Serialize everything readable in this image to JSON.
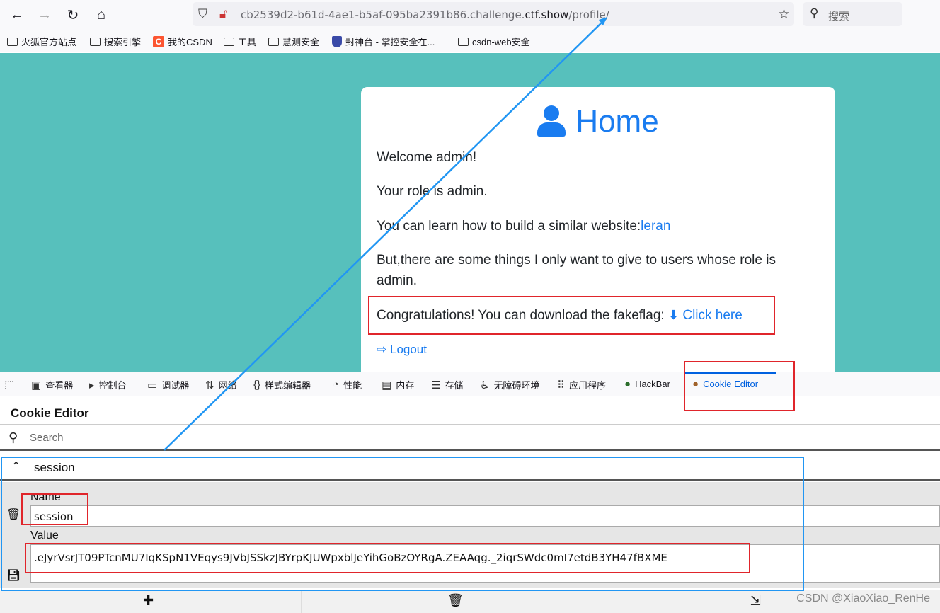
{
  "browser": {
    "url_host": "cb2539d2-b61d-4ae1-b5af-095ba2391b86.challenge.",
    "url_domain": "ctf.show",
    "url_path": "/profile/",
    "search_placeholder": "搜索"
  },
  "bookmarks": [
    "火狐官方站点",
    "搜索引擎",
    "我的CSDN",
    "工具",
    "慧测安全",
    "封神台 - 掌控安全在...",
    "csdn-web安全"
  ],
  "page": {
    "title": "Home",
    "welcome": "Welcome admin!",
    "role": "Your role is admin.",
    "learn_prefix": "You can learn how to build a similar website:",
    "learn_link": "leran",
    "note": "But,there are some things I only want to give to users whose role is admin.",
    "congrats": "Congratulations! You can download the fakeflag:",
    "click_here": "Click here",
    "logout": "Logout"
  },
  "devtools": {
    "tabs": [
      "查看器",
      "控制台",
      "调试器",
      "网络",
      "样式编辑器",
      "性能",
      "内存",
      "存储",
      "无障碍环境",
      "应用程序",
      "HackBar",
      "Cookie Editor"
    ],
    "active_tab": "Cookie Editor"
  },
  "cookie_editor": {
    "title": "Cookie Editor",
    "search_placeholder": "Search",
    "cookie_name": "session",
    "name_label": "Name",
    "name_value": "session",
    "value_label": "Value",
    "value": ".eJyrVsrJT09PTcnMU7IqKSpN1VEqys9JVbJSSkzJBYrpKJUWpxblJeYihGoBzOYRgA.ZEAAqg._2iqrSWdc0mI7etdB3YH47fBXME"
  },
  "watermark": "CSDN @XiaoXiao_RenHe",
  "colors": {
    "page_bg": "#57c0bc",
    "link": "#1a7cf0",
    "annotation_red": "#e0252b",
    "annotation_blue": "#2196f3"
  }
}
